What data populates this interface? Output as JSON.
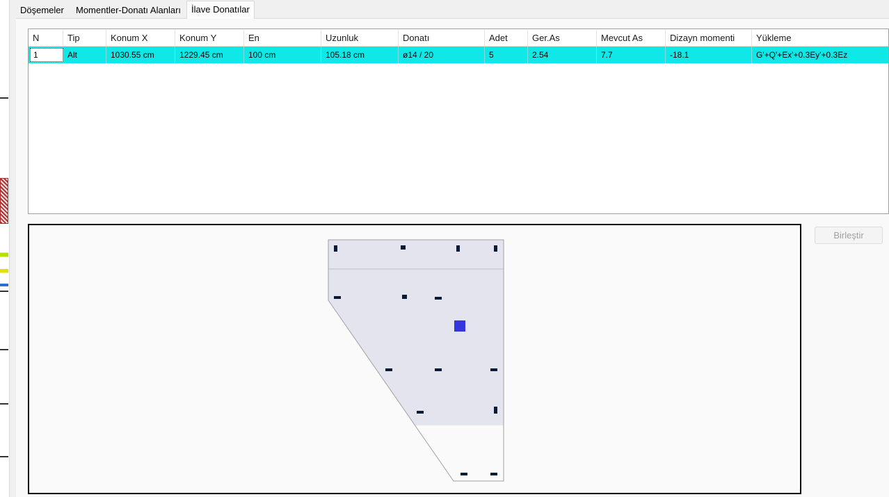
{
  "tabs": [
    {
      "label": "Döşemeler"
    },
    {
      "label": "Momentler-Donatı Alanları"
    },
    {
      "label": "İlave Donatılar"
    }
  ],
  "grid": {
    "columns": [
      "N",
      "Tip",
      "Konum X",
      "Konum Y",
      "En",
      "Uzunluk",
      "Donatı",
      "Adet",
      "Ger.As",
      "Mevcut As",
      "Dizayn momenti",
      "Yükleme"
    ],
    "rows": [
      [
        "1",
        "Alt",
        "1030.55 cm",
        "1229.45 cm",
        "100 cm",
        "105.18 cm",
        "ø14 / 20",
        "5",
        "2.54",
        "7.7",
        "-18.1",
        "G'+Q'+Ex'+0.3Ey'+0.3Ez"
      ]
    ],
    "selected_row_color": "#10e8e8"
  },
  "buttons": {
    "merge_label": "Birleştir"
  },
  "drawing": {
    "slab_fill": "#e4e4ee",
    "outline_color": "#a0a0a0",
    "column_color": "#0a1a33",
    "selected_color": "#3535e0",
    "column_count": 16
  }
}
